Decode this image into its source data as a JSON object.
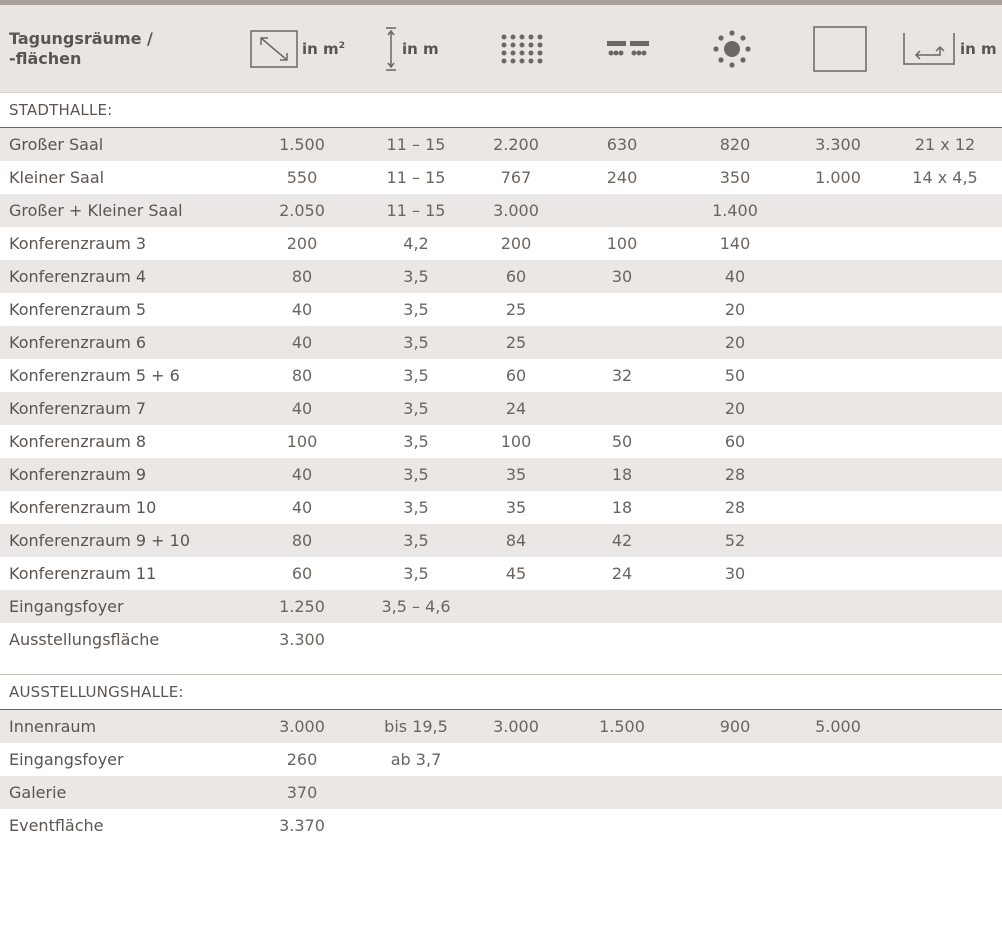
{
  "header": {
    "title_line1": "Tagungsräume /",
    "title_line2": "-flächen",
    "area_unit": "in m",
    "area_sup": "2",
    "height_unit": "in m",
    "dims_unit": "in m",
    "icons": [
      "area-diagonal-icon",
      "height-arrow-icon",
      "theater-seating-icon",
      "classroom-seating-icon",
      "banquet-seating-icon",
      "standing-square-icon",
      "room-dimensions-icon"
    ]
  },
  "sections": [
    {
      "label": "STADTHALLE:",
      "rows": [
        {
          "name": "Großer Saal",
          "area": "1.500",
          "height": "11 – 15",
          "c3": "2.200",
          "c4": "630",
          "c5": "820",
          "c6": "3.300",
          "c7": "21 x 12"
        },
        {
          "name": "Kleiner Saal",
          "area": "550",
          "height": "11 – 15",
          "c3": "767",
          "c4": "240",
          "c5": "350",
          "c6": "1.000",
          "c7": "14 x 4,5"
        },
        {
          "name": "Großer + Kleiner Saal",
          "area": "2.050",
          "height": "11 – 15",
          "c3": "3.000",
          "c4": "",
          "c5": "1.400",
          "c6": "",
          "c7": ""
        },
        {
          "name": "Konferenzraum 3",
          "area": "200",
          "height": "4,2",
          "c3": "200",
          "c4": "100",
          "c5": "140",
          "c6": "",
          "c7": ""
        },
        {
          "name": "Konferenzraum 4",
          "area": "80",
          "height": "3,5",
          "c3": "60",
          "c4": "30",
          "c5": "40",
          "c6": "",
          "c7": ""
        },
        {
          "name": "Konferenzraum 5",
          "area": "40",
          "height": "3,5",
          "c3": "25",
          "c4": "",
          "c5": "20",
          "c6": "",
          "c7": ""
        },
        {
          "name": "Konferenzraum 6",
          "area": "40",
          "height": "3,5",
          "c3": "25",
          "c4": "",
          "c5": "20",
          "c6": "",
          "c7": ""
        },
        {
          "name": "Konferenzraum 5 + 6",
          "area": "80",
          "height": "3,5",
          "c3": "60",
          "c4": "32",
          "c5": "50",
          "c6": "",
          "c7": ""
        },
        {
          "name": "Konferenzraum 7",
          "area": "40",
          "height": "3,5",
          "c3": "24",
          "c4": "",
          "c5": "20",
          "c6": "",
          "c7": ""
        },
        {
          "name": "Konferenzraum 8",
          "area": "100",
          "height": "3,5",
          "c3": "100",
          "c4": "50",
          "c5": "60",
          "c6": "",
          "c7": ""
        },
        {
          "name": "Konferenzraum 9",
          "area": "40",
          "height": "3,5",
          "c3": "35",
          "c4": "18",
          "c5": "28",
          "c6": "",
          "c7": ""
        },
        {
          "name": "Konferenzraum 10",
          "area": "40",
          "height": "3,5",
          "c3": "35",
          "c4": "18",
          "c5": "28",
          "c6": "",
          "c7": ""
        },
        {
          "name": "Konferenzraum 9 + 10",
          "area": "80",
          "height": "3,5",
          "c3": "84",
          "c4": "42",
          "c5": "52",
          "c6": "",
          "c7": ""
        },
        {
          "name": "Konferenzraum 11",
          "area": "60",
          "height": "3,5",
          "c3": "45",
          "c4": "24",
          "c5": "30",
          "c6": "",
          "c7": ""
        },
        {
          "name": "Eingangsfoyer",
          "area": "1.250",
          "height": "3,5 – 4,6",
          "c3": "",
          "c4": "",
          "c5": "",
          "c6": "",
          "c7": ""
        },
        {
          "name": "Ausstellungsfläche",
          "area": "3.300",
          "height": "",
          "c3": "",
          "c4": "",
          "c5": "",
          "c6": "",
          "c7": ""
        }
      ]
    },
    {
      "label": "AUSSTELLUNGSHALLE:",
      "rows": [
        {
          "name": "Innenraum",
          "area": "3.000",
          "height": "bis 19,5",
          "c3": "3.000",
          "c4": "1.500",
          "c5": "900",
          "c6": "5.000",
          "c7": ""
        },
        {
          "name": "Eingangsfoyer",
          "area": "260",
          "height": "ab 3,7",
          "c3": "",
          "c4": "",
          "c5": "",
          "c6": "",
          "c7": ""
        },
        {
          "name": "Galerie",
          "area": "370",
          "height": "",
          "c3": "",
          "c4": "",
          "c5": "",
          "c6": "",
          "c7": ""
        },
        {
          "name": "Eventfläche",
          "area": "3.370",
          "height": "",
          "c3": "",
          "c4": "",
          "c5": "",
          "c6": "",
          "c7": ""
        }
      ]
    }
  ]
}
